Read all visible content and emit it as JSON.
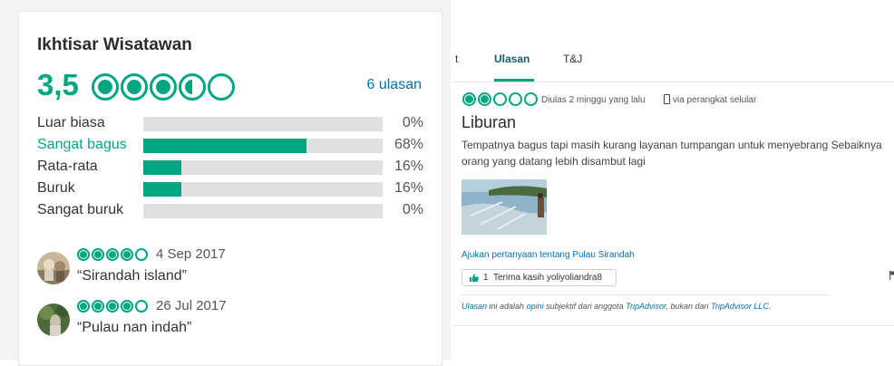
{
  "left": {
    "title": "Ikhtisar Wisatawan",
    "score": "3,5",
    "bubble_rating": 3.5,
    "review_count_link": "6 ulasan",
    "distribution": [
      {
        "label": "Luar biasa",
        "percent_text": "0%",
        "value": 0,
        "highlight": false
      },
      {
        "label": "Sangat bagus",
        "percent_text": "68%",
        "value": 68,
        "highlight": true
      },
      {
        "label": "Rata-rata",
        "percent_text": "16%",
        "value": 16,
        "highlight": false
      },
      {
        "label": "Buruk",
        "percent_text": "16%",
        "value": 16,
        "highlight": false
      },
      {
        "label": "Sangat buruk",
        "percent_text": "0%",
        "value": 0,
        "highlight": false
      }
    ],
    "snippets": [
      {
        "rating": 4,
        "date": "4 Sep 2017",
        "title": "“Sirandah island”"
      },
      {
        "rating": 4,
        "date": "26 Jul 2017",
        "title": "“Pulau nan indah”"
      }
    ]
  },
  "tabs": [
    {
      "label": "t",
      "active": false
    },
    {
      "label": "Ulasan",
      "active": true
    },
    {
      "label": "T&J",
      "active": false
    }
  ],
  "review": {
    "rating": 2,
    "date_text": "Diulas 2 minggu yang lalu",
    "device_text": "via perangkat selular",
    "title": "Liburan",
    "body_line1": "Tempatnya bagus tapi masih kurang layanan tumpangan untuk menyebrang Sebaiknya",
    "body_line2": "orang yang datang lebih disambut lagi",
    "ask_link": "Ajukan pertanyaan tentang Pulau Sirandah",
    "thanks_count": "1",
    "thanks_text": "Terima kasih yoliyoliandra8",
    "disclaimer": {
      "w1": "Ulasan",
      "t1": " ini adalah ",
      "w2": "opini",
      "t2": " subjektif dari anggota ",
      "w3": "TripAdvisor",
      "t3": ", bukan dari ",
      "w4": "TripAdvisor LLC",
      "t4": "."
    }
  },
  "icons": {
    "bubble": "rating-bubble-icon",
    "phone": "mobile-phone-icon",
    "thumb": "thumbs-up-icon",
    "flag": "flag-icon"
  },
  "colors": {
    "brand_green": "#00a680",
    "link_blue": "#0072b1",
    "bar_track": "#e0e0e0"
  }
}
